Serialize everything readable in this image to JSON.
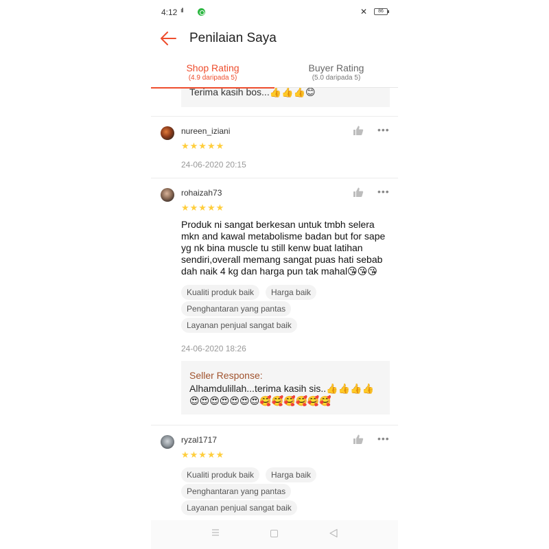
{
  "status_bar": {
    "time": "4:12",
    "signal": "ıll",
    "battery": "86"
  },
  "header": {
    "title": "Penilaian Saya"
  },
  "tabs": [
    {
      "label": "Shop Rating",
      "sub": "(4.9 daripada 5)",
      "active": true
    },
    {
      "label": "Buyer Rating",
      "sub": "(5.0 daripada 5)",
      "active": false
    }
  ],
  "previous_response": {
    "text": "Terima kasih bos...👍👍👍😊"
  },
  "reviews": [
    {
      "username": "nureen_iziani",
      "stars": "★★★★★",
      "rating": 5,
      "date": "24-06-2020 20:15"
    },
    {
      "username": "rohaizah73",
      "stars": "★★★★★",
      "rating": 5,
      "text": "Produk ni sangat berkesan untuk tmbh selera mkn and kawal metabolisme badan but for sape yg nk bina muscle tu still kenw buat latihan sendiri,overall memang sangat puas hati sebab dah naik 4 kg dan harga pun tak mahal😘😘😘",
      "tags": [
        "Kualiti produk baik",
        "Harga baik",
        "Penghantaran yang pantas",
        "Layanan penjual sangat baik"
      ],
      "date": "24-06-2020 18:26",
      "seller_response_title": "Seller Response:",
      "seller_response_text": "Alhamdulillah...terima kasih sis..👍👍👍👍 😍😍😍😍😍😍😍🥰🥰🥰🥰🥰🥰"
    },
    {
      "username": "ryzal1717",
      "stars": "★★★★★",
      "rating": 5,
      "tags": [
        "Kualiti produk baik",
        "Harga baik",
        "Penghantaran yang pantas",
        "Layanan penjual sangat baik"
      ]
    }
  ],
  "icons": {
    "back": "arrow-left-icon",
    "like": "thumbs-up-icon",
    "more": "more-dots-icon",
    "nav_menu": "menu-icon",
    "nav_home": "square-icon",
    "nav_back": "triangle-back-icon"
  },
  "colors": {
    "accent": "#ee4d2d",
    "star": "#ffce3d",
    "seller_title": "#a0522d"
  }
}
